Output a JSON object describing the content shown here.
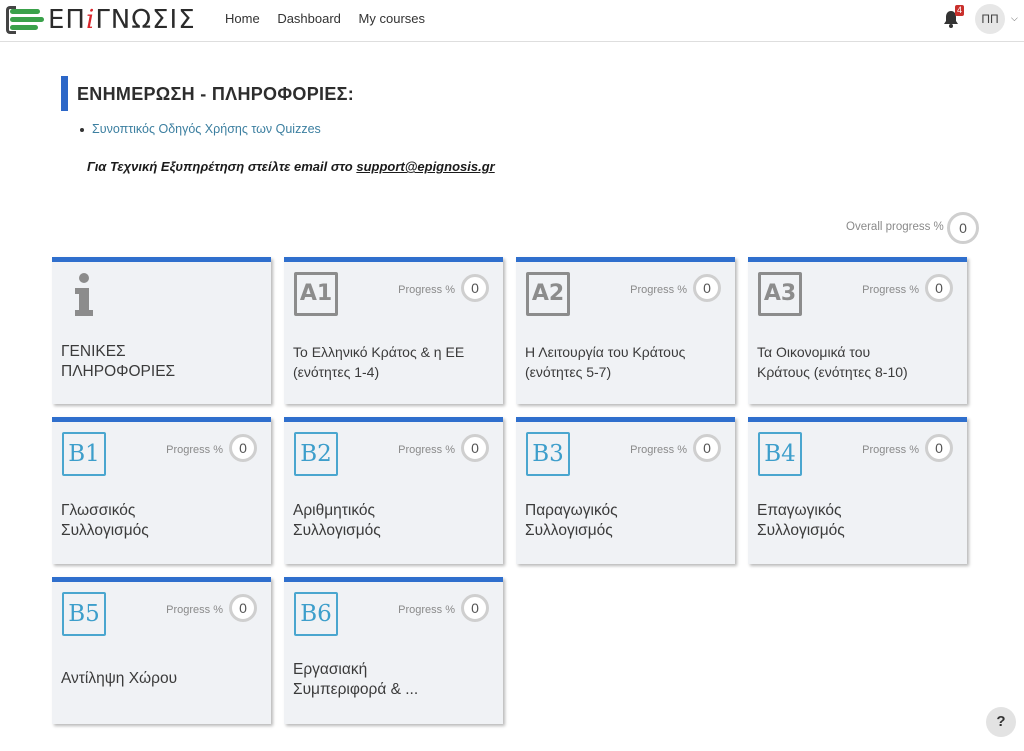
{
  "brand": {
    "logo_text_a": "ΕΠ",
    "logo_text_i": "i",
    "logo_text_b": "ΓΝΩΣΙΣ"
  },
  "nav": {
    "links": [
      "Home",
      "Dashboard",
      "My courses"
    ]
  },
  "header": {
    "notification_count": "4",
    "user_initials": "ΠΠ"
  },
  "info": {
    "title": "ΕΝΗΜΕΡΩΣΗ - ΠΛΗΡΟΦΟΡΙΕΣ:",
    "link": "Συνοπτικός Οδηγός Χρήσης των Quizzes",
    "support_prefix": "Για Τεχνική Εξυπηρέτηση στείλτε email στο ",
    "support_email": "support@epignosis.gr"
  },
  "overall": {
    "label": "Overall progress %",
    "value": "0"
  },
  "courses": [
    {
      "icon": "info-icon",
      "code": "",
      "title_l1": "ΓΕΝΙΚΕΣ",
      "title_l2": "ΠΛΗΡΟΦΟΡΙΕΣ",
      "progress_label": "",
      "progress": ""
    },
    {
      "icon": "A1-icon",
      "code": "A1",
      "title_l1": "Το Ελληνικό Κράτος & η ΕΕ",
      "title_l2": "(ενότητες 1-4)",
      "progress_label": "Progress %",
      "progress": "0"
    },
    {
      "icon": "A2-icon",
      "code": "A2",
      "title_l1": "Η Λειτουργία του Κράτους",
      "title_l2": "(ενότητες 5-7)",
      "progress_label": "Progress %",
      "progress": "0"
    },
    {
      "icon": "A3-icon",
      "code": "A3",
      "title_l1": "Τα Οικονομικά του",
      "title_l2": "Κράτους (ενότητες 8-10)",
      "progress_label": "Progress %",
      "progress": "0"
    },
    {
      "icon": "B1-icon",
      "code": "B1",
      "title_l1": "Γλωσσικός",
      "title_l2": "Συλλογισμός",
      "progress_label": "Progress %",
      "progress": "0"
    },
    {
      "icon": "B2-icon",
      "code": "B2",
      "title_l1": "Αριθμητικός",
      "title_l2": "Συλλογισμός",
      "progress_label": "Progress %",
      "progress": "0"
    },
    {
      "icon": "B3-icon",
      "code": "B3",
      "title_l1": "Παραγωγικός",
      "title_l2": "Συλλογισμός",
      "progress_label": "Progress %",
      "progress": "0"
    },
    {
      "icon": "B4-icon",
      "code": "B4",
      "title_l1": "Επαγωγικός",
      "title_l2": "Συλλογισμός",
      "progress_label": "Progress %",
      "progress": "0"
    },
    {
      "icon": "B5-icon",
      "code": "B5",
      "title_l1": "Αντίληψη Χώρου",
      "title_l2": "",
      "progress_label": "Progress %",
      "progress": "0"
    },
    {
      "icon": "B6-icon",
      "code": "B6",
      "title_l1": "Εργασιακή",
      "title_l2": "Συμπεριφορά & ...",
      "progress_label": "Progress %",
      "progress": "0"
    }
  ],
  "help": {
    "label": "?"
  },
  "colors": {
    "accent": "#2f6fcd",
    "card_bg": "#f0f2f5",
    "link": "#3c7fa0",
    "b_icon": "#4aa6cf"
  }
}
